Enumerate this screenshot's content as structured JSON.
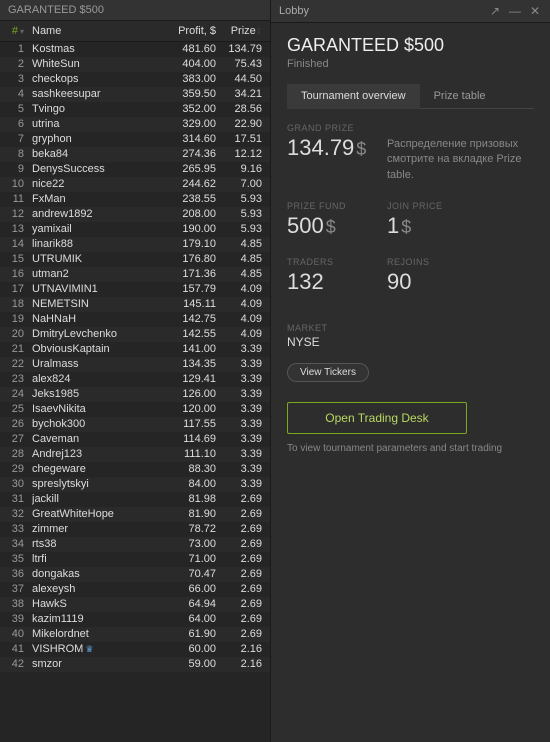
{
  "leaderboard": {
    "title": "GARANTEED $500",
    "columns": {
      "rank": "#",
      "name": "Name",
      "profit": "Profit, $",
      "prize": "Prize"
    },
    "rows": [
      {
        "rank": 1,
        "name": "Kostmas",
        "profit": "481.60",
        "prize": "134.79"
      },
      {
        "rank": 2,
        "name": "WhiteSun",
        "profit": "404.00",
        "prize": "75.43"
      },
      {
        "rank": 3,
        "name": "checkops",
        "profit": "383.00",
        "prize": "44.50"
      },
      {
        "rank": 4,
        "name": "sashkeesupar",
        "profit": "359.50",
        "prize": "34.21"
      },
      {
        "rank": 5,
        "name": "Tvingo",
        "profit": "352.00",
        "prize": "28.56"
      },
      {
        "rank": 6,
        "name": "utrina",
        "profit": "329.00",
        "prize": "22.90"
      },
      {
        "rank": 7,
        "name": "gryphon",
        "profit": "314.60",
        "prize": "17.51"
      },
      {
        "rank": 8,
        "name": "beka84",
        "profit": "274.36",
        "prize": "12.12"
      },
      {
        "rank": 9,
        "name": "DenysSuccess",
        "profit": "265.95",
        "prize": "9.16"
      },
      {
        "rank": 10,
        "name": "nice22",
        "profit": "244.62",
        "prize": "7.00"
      },
      {
        "rank": 11,
        "name": "FxMan",
        "profit": "238.55",
        "prize": "5.93"
      },
      {
        "rank": 12,
        "name": "andrew1892",
        "profit": "208.00",
        "prize": "5.93"
      },
      {
        "rank": 13,
        "name": "yamixail",
        "profit": "190.00",
        "prize": "5.93"
      },
      {
        "rank": 14,
        "name": "linarik88",
        "profit": "179.10",
        "prize": "4.85"
      },
      {
        "rank": 15,
        "name": "UTRUMIK",
        "profit": "176.80",
        "prize": "4.85"
      },
      {
        "rank": 16,
        "name": "utman2",
        "profit": "171.36",
        "prize": "4.85"
      },
      {
        "rank": 17,
        "name": "UTNAVIMIN1",
        "profit": "157.79",
        "prize": "4.09"
      },
      {
        "rank": 18,
        "name": "NEMETSIN",
        "profit": "145.11",
        "prize": "4.09"
      },
      {
        "rank": 19,
        "name": "NaHNaH",
        "profit": "142.75",
        "prize": "4.09"
      },
      {
        "rank": 20,
        "name": "DmitryLevchenko",
        "profit": "142.55",
        "prize": "4.09"
      },
      {
        "rank": 21,
        "name": "ObviousKaptain",
        "profit": "141.00",
        "prize": "3.39"
      },
      {
        "rank": 22,
        "name": "Uralmass",
        "profit": "134.35",
        "prize": "3.39"
      },
      {
        "rank": 23,
        "name": "alex824",
        "profit": "129.41",
        "prize": "3.39"
      },
      {
        "rank": 24,
        "name": "Jeks1985",
        "profit": "126.00",
        "prize": "3.39"
      },
      {
        "rank": 25,
        "name": "IsaevNikita",
        "profit": "120.00",
        "prize": "3.39"
      },
      {
        "rank": 26,
        "name": "bychok300",
        "profit": "117.55",
        "prize": "3.39"
      },
      {
        "rank": 27,
        "name": "Caveman",
        "profit": "114.69",
        "prize": "3.39"
      },
      {
        "rank": 28,
        "name": "Andrej123",
        "profit": "111.10",
        "prize": "3.39"
      },
      {
        "rank": 29,
        "name": "chegeware",
        "profit": "88.30",
        "prize": "3.39"
      },
      {
        "rank": 30,
        "name": "spreslytskyi",
        "profit": "84.00",
        "prize": "3.39"
      },
      {
        "rank": 31,
        "name": "jackill",
        "profit": "81.98",
        "prize": "2.69"
      },
      {
        "rank": 32,
        "name": "GreatWhiteHope",
        "profit": "81.90",
        "prize": "2.69"
      },
      {
        "rank": 33,
        "name": "zimmer",
        "profit": "78.72",
        "prize": "2.69"
      },
      {
        "rank": 34,
        "name": "rts38",
        "profit": "73.00",
        "prize": "2.69"
      },
      {
        "rank": 35,
        "name": "ltrfi",
        "profit": "71.00",
        "prize": "2.69"
      },
      {
        "rank": 36,
        "name": "dongakas",
        "profit": "70.47",
        "prize": "2.69"
      },
      {
        "rank": 37,
        "name": "alexeysh",
        "profit": "66.00",
        "prize": "2.69"
      },
      {
        "rank": 38,
        "name": "HawkS",
        "profit": "64.94",
        "prize": "2.69"
      },
      {
        "rank": 39,
        "name": "kazim1119",
        "profit": "64.00",
        "prize": "2.69"
      },
      {
        "rank": 40,
        "name": "Mikelordnet",
        "profit": "61.90",
        "prize": "2.69"
      },
      {
        "rank": 41,
        "name": "VISHROM",
        "profit": "60.00",
        "prize": "2.16",
        "crown": true
      },
      {
        "rank": 42,
        "name": "smzor",
        "profit": "59.00",
        "prize": "2.16"
      }
    ]
  },
  "lobby": {
    "header": "Lobby",
    "title": "GARANTEED $500",
    "status": "Finished",
    "tabs": {
      "overview": "Tournament overview",
      "prize": "Prize table"
    },
    "grand_prize": {
      "label": "GRAND PRIZE",
      "value": "134.79",
      "unit": "$"
    },
    "distribution": "Распределение призовых смотрите на вкладке Prize table.",
    "prize_fund": {
      "label": "PRIZE FUND",
      "value": "500",
      "unit": "$"
    },
    "join_price": {
      "label": "JOIN PRICE",
      "value": "1",
      "unit": "$"
    },
    "traders": {
      "label": "TRADERS",
      "value": "132"
    },
    "rejoins": {
      "label": "REJOINS",
      "value": "90"
    },
    "market": {
      "label": "MARKET",
      "value": "NYSE"
    },
    "view_tickers": "View Tickers",
    "open_desk": "Open Trading Desk",
    "help": "To view tournament parameters and start trading"
  }
}
